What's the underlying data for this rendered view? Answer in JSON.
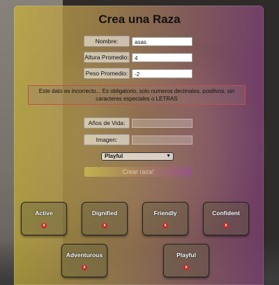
{
  "title": "Crea una Raza",
  "form": {
    "nombre": {
      "label": "Nombre:",
      "value": "asas"
    },
    "altura": {
      "label": "Altura Promedio:",
      "value": "4"
    },
    "peso": {
      "label": "Peso Promedio:",
      "value": "-2"
    },
    "error_message": "Este dato es incorrecto... Es obligatorio, solo numeros decimales, positivos, sin caracteres especiales o LETRAS",
    "anios": {
      "label": "Años de Vida:",
      "value": ""
    },
    "imagen": {
      "label": "Imagen:",
      "value": ""
    },
    "temperament_select": {
      "value": "Playful"
    },
    "submit_label": "Crear raza!"
  },
  "temperaments": [
    {
      "name": "Active",
      "remove": "x"
    },
    {
      "name": "Dignified",
      "remove": "x"
    },
    {
      "name": "Friendly",
      "remove": "x"
    },
    {
      "name": "Confident",
      "remove": "x"
    },
    {
      "name": "Adventurous",
      "remove": "x"
    },
    {
      "name": "Playful",
      "remove": "x"
    }
  ],
  "colors": {
    "error_border": "#c0504d",
    "remove_button": "#c62828",
    "panel_gradient": [
      "#c4af3c",
      "#b48c5a",
      "#8c4682"
    ]
  }
}
